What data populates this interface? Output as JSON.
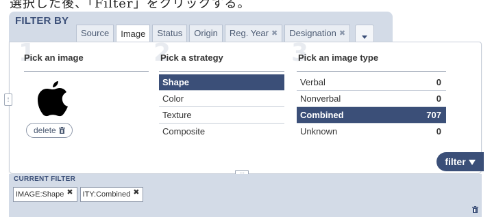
{
  "caption": "選択した後、「Filter」をクリックする。",
  "filter_by": {
    "title": "FILTER BY",
    "tabs": [
      {
        "label": "Source",
        "closable": false,
        "active": false
      },
      {
        "label": "Image",
        "closable": false,
        "active": true
      },
      {
        "label": "Status",
        "closable": false,
        "active": false
      },
      {
        "label": "Origin",
        "closable": false,
        "active": false
      },
      {
        "label": "Reg. Year",
        "closable": true,
        "active": false
      },
      {
        "label": "Designation",
        "closable": true,
        "active": false
      }
    ],
    "more_icon": "chevron-down-icon",
    "close_glyph": "✖"
  },
  "step1": {
    "number": "1",
    "title": "Pick an image",
    "image_icon": "apple-logo-icon",
    "delete_label": "delete"
  },
  "step2": {
    "number": "2",
    "title": "Pick a strategy",
    "options": [
      {
        "label": "Shape",
        "selected": true
      },
      {
        "label": "Color",
        "selected": false
      },
      {
        "label": "Texture",
        "selected": false
      },
      {
        "label": "Composite",
        "selected": false
      }
    ]
  },
  "step3": {
    "number": "3",
    "title": "Pick an image type",
    "types": [
      {
        "label": "Verbal",
        "count": "0",
        "selected": false
      },
      {
        "label": "Nonverbal",
        "count": "0",
        "selected": false
      },
      {
        "label": "Combined",
        "count": "707",
        "selected": true
      },
      {
        "label": "Unknown",
        "count": "0",
        "selected": false
      }
    ]
  },
  "filter_button": {
    "label": "filter"
  },
  "current_filter": {
    "label": "CURRENT FILTER",
    "chips": [
      {
        "label": "IMAGE:Shape"
      },
      {
        "label": "ITY:Combined"
      }
    ]
  },
  "colors": {
    "accent": "#3b4f78",
    "panel_bg": "#d3dbe7",
    "tab_bg": "#e9edf3"
  }
}
